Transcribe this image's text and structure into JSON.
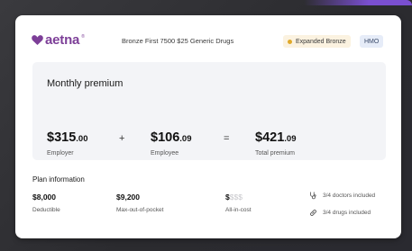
{
  "brand": {
    "logo_text": "aetna",
    "trademark": "®"
  },
  "plan": {
    "name": "Bronze First 7500 $25 Generic Drugs",
    "metal_badge": "Expanded Bronze",
    "network_badge": "HMO"
  },
  "premium": {
    "title": "Monthly premium",
    "employer": {
      "dollars": "$315",
      "cents": ".00",
      "label": "Employer"
    },
    "plus": "+",
    "employee": {
      "dollars": "$106",
      "cents": ".09",
      "label": "Employee"
    },
    "equals": "=",
    "total": {
      "dollars": "$421",
      "cents": ".09",
      "label": "Total premium"
    }
  },
  "plan_info": {
    "title": "Plan information",
    "deductible": {
      "value": "$8,000",
      "label": "Deductible"
    },
    "max_oop": {
      "value": "$9,200",
      "label": "Max-out-of-pocket"
    },
    "all_in_cost": {
      "value": "$",
      "dim_value": "$$$",
      "label": "All-in-cost"
    },
    "doctors_included": "3/4 doctors included",
    "drugs_included": "3/4 drugs included"
  },
  "colors": {
    "brand_purple": "#7d3f98",
    "bronze_dot": "#e0a92a",
    "bronze_badge_bg": "#fbf2e0",
    "hmo_badge_bg": "#e6ecf8",
    "panel_bg": "#f3f4f7"
  },
  "icons": {
    "logo": "heart-icon",
    "doctors": "stethoscope-icon",
    "drugs": "pill-icon"
  }
}
